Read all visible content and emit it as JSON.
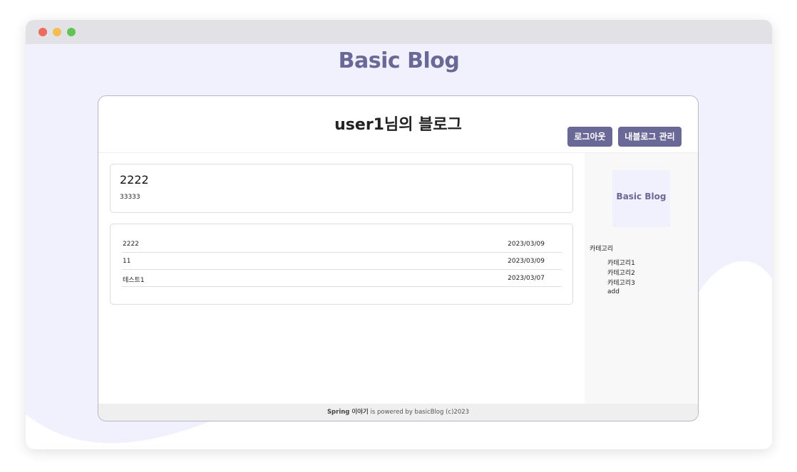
{
  "colors": {
    "accent": "#6a6896",
    "background": "#f1f0fd",
    "sidebar": "#f8f8f8",
    "footer": "#efefef"
  },
  "header": {
    "site_title": "Basic Blog"
  },
  "blog": {
    "name": "user1님의 블로그",
    "logout_label": "로그아웃",
    "manage_label": "내블로그 관리"
  },
  "post": {
    "title": "2222",
    "body": "33333"
  },
  "post_list": [
    {
      "title": "2222",
      "date": "2023/03/09"
    },
    {
      "title": "11",
      "date": "2023/03/09"
    },
    {
      "title": "테스트1",
      "date": "2023/03/07"
    }
  ],
  "sidebar": {
    "logo_text": "Basic Blog",
    "category_heading": "카테고리",
    "categories": [
      "카테고리1",
      "카테고리2",
      "카테고리3",
      "add"
    ]
  },
  "footer": {
    "brand": "Spring 이야기",
    "text": " is powered by basicBlog (c)2023"
  }
}
